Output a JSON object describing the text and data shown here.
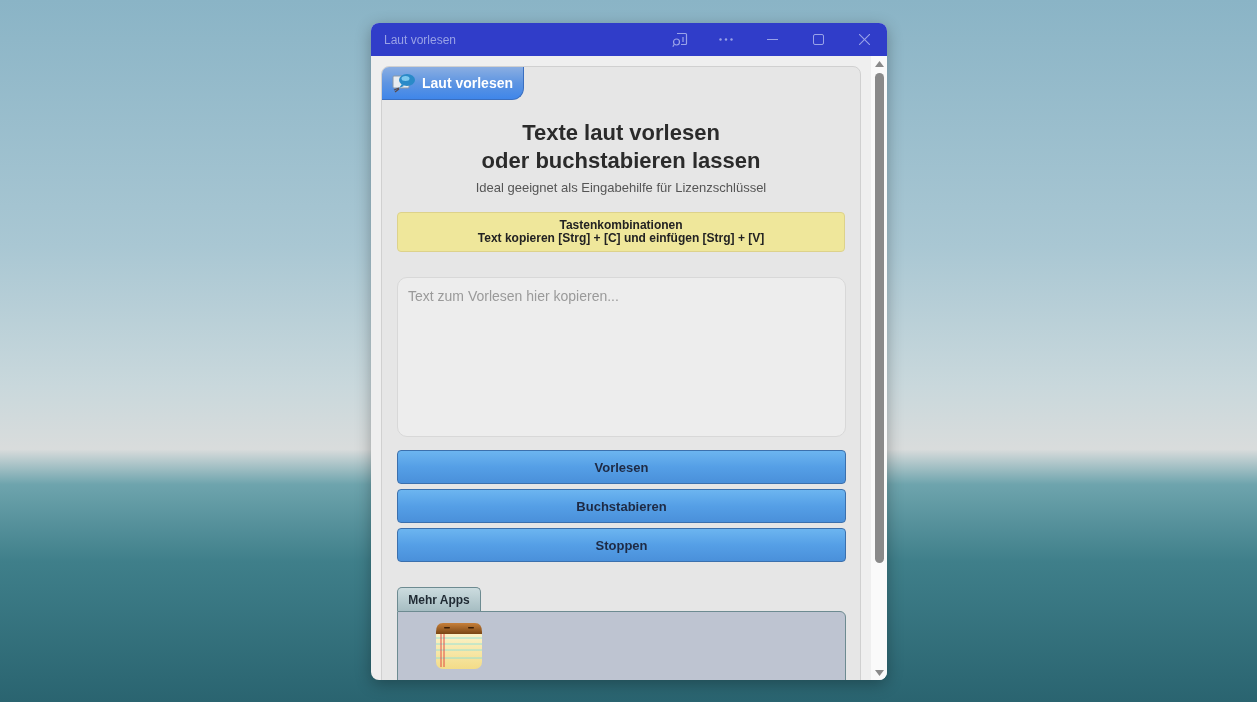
{
  "window": {
    "title": "Laut vorlesen"
  },
  "app": {
    "tab": {
      "label": "Laut vorlesen"
    },
    "heading": "Texte laut vorlesen\noder buchstabieren lassen",
    "subtitle": "Ideal geeignet als Eingabehilfe für Lizenzschlüssel",
    "shortcuts": {
      "title": "Tastenkombinationen",
      "text": "Text kopieren [Strg] + [C] und einfügen [Strg] + [V]"
    },
    "text_input": {
      "placeholder": "Text zum Vorlesen hier kopieren..."
    },
    "buttons": [
      "Vorlesen",
      "Buchstabieren",
      "Stoppen"
    ]
  },
  "more_apps": {
    "tab": {
      "label": "Mehr Apps"
    },
    "apps": [
      {
        "kind": "notepad"
      }
    ]
  }
}
